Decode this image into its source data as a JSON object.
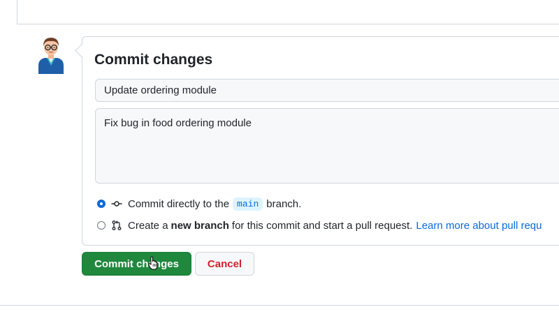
{
  "dialog": {
    "title": "Commit changes",
    "summary_value": "Update ordering module",
    "description_value": "Fix bug in food ordering module"
  },
  "options": {
    "direct": {
      "selected": true,
      "prefix": "Commit directly to the",
      "branch": "main",
      "suffix": "branch."
    },
    "new_branch": {
      "selected": false,
      "prefix": "Create a",
      "bold": "new branch",
      "suffix": "for this commit and start a pull request.",
      "link": "Learn more about pull requ"
    }
  },
  "buttons": {
    "commit_label": "Commit changes",
    "cancel_label": "Cancel"
  },
  "icons": {
    "avatar": "avatar",
    "commit": "git-commit-icon",
    "pull_request": "git-pull-request-icon",
    "cursor": "hand-pointer-cursor"
  },
  "colors": {
    "primary_green": "#1f883d",
    "link_blue": "#0969da",
    "danger_red": "#cf222e"
  }
}
